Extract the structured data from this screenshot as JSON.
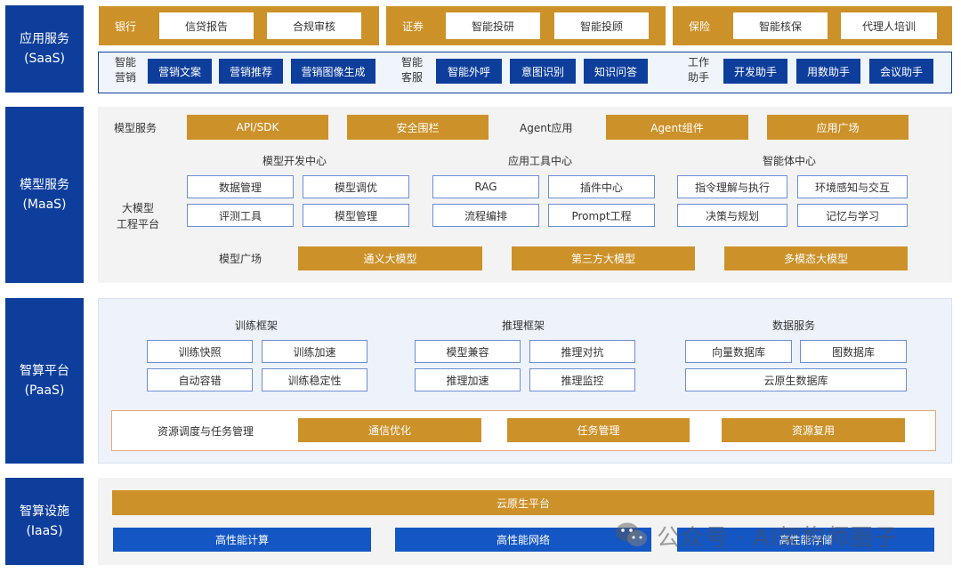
{
  "layers": {
    "saas": [
      "应用服务",
      "(SaaS)"
    ],
    "maas": [
      "模型服务",
      "(MaaS)"
    ],
    "paas": [
      "智算平台",
      "(PaaS)"
    ],
    "iaas": [
      "智算设施",
      "(IaaS)"
    ]
  },
  "saas": {
    "bank": {
      "title": "银行",
      "items": [
        "信贷报告",
        "合规审核"
      ]
    },
    "securities": {
      "title": "证券",
      "items": [
        "智能投研",
        "智能投顾"
      ]
    },
    "insurance": {
      "title": "保险",
      "items": [
        "智能核保",
        "代理人培训"
      ]
    },
    "marketing": {
      "title": [
        "智能",
        "营销"
      ],
      "items": [
        "营销文案",
        "营销推荐",
        "营销图像生成"
      ]
    },
    "service": {
      "title": [
        "智能",
        "客服"
      ],
      "items": [
        "智能外呼",
        "意图识别",
        "知识问答"
      ]
    },
    "work": {
      "title": [
        "工作",
        "助手"
      ],
      "items": [
        "开发助手",
        "用数助手",
        "会议助手"
      ]
    }
  },
  "maas": {
    "model_service_label": "模型服务",
    "api_sdk": "API/SDK",
    "guardrail": "安全围栏",
    "agent_app_label": "Agent应用",
    "agent_component": "Agent组件",
    "app_plaza": "应用广场",
    "platform_label": [
      "大模型",
      "工程平台"
    ],
    "dev_center": {
      "title": "模型开发中心",
      "items": [
        "数据管理",
        "模型调优",
        "评测工具",
        "模型管理"
      ]
    },
    "tool_center": {
      "title": "应用工具中心",
      "items": [
        "RAG",
        "插件中心",
        "流程编排",
        "Prompt工程"
      ]
    },
    "agent_center": {
      "title": "智能体中心",
      "items": [
        "指令理解与执行",
        "环境感知与交互",
        "决策与规划",
        "记忆与学习"
      ]
    },
    "plaza_label": "模型广场",
    "models": [
      "通义大模型",
      "第三方大模型",
      "多模态大模型"
    ]
  },
  "paas": {
    "training": {
      "title": "训练框架",
      "items": [
        "训练快照",
        "训练加速",
        "自动容错",
        "训练稳定性"
      ]
    },
    "inference": {
      "title": "推理框架",
      "items": [
        "模型兼容",
        "推理对抗",
        "推理加速",
        "推理监控"
      ]
    },
    "data": {
      "title": "数据服务",
      "items": [
        "向量数据库",
        "图数据库",
        "云原生数据库"
      ]
    },
    "scheduling_label": "资源调度与任务管理",
    "scheduling": [
      "通信优化",
      "任务管理",
      "资源复用"
    ]
  },
  "iaas": {
    "cloud_native": "云原生平台",
    "infra": [
      "高性能计算",
      "高性能网络",
      "高性能存储"
    ]
  },
  "watermark": "公众号 · AI架构师圈子"
}
